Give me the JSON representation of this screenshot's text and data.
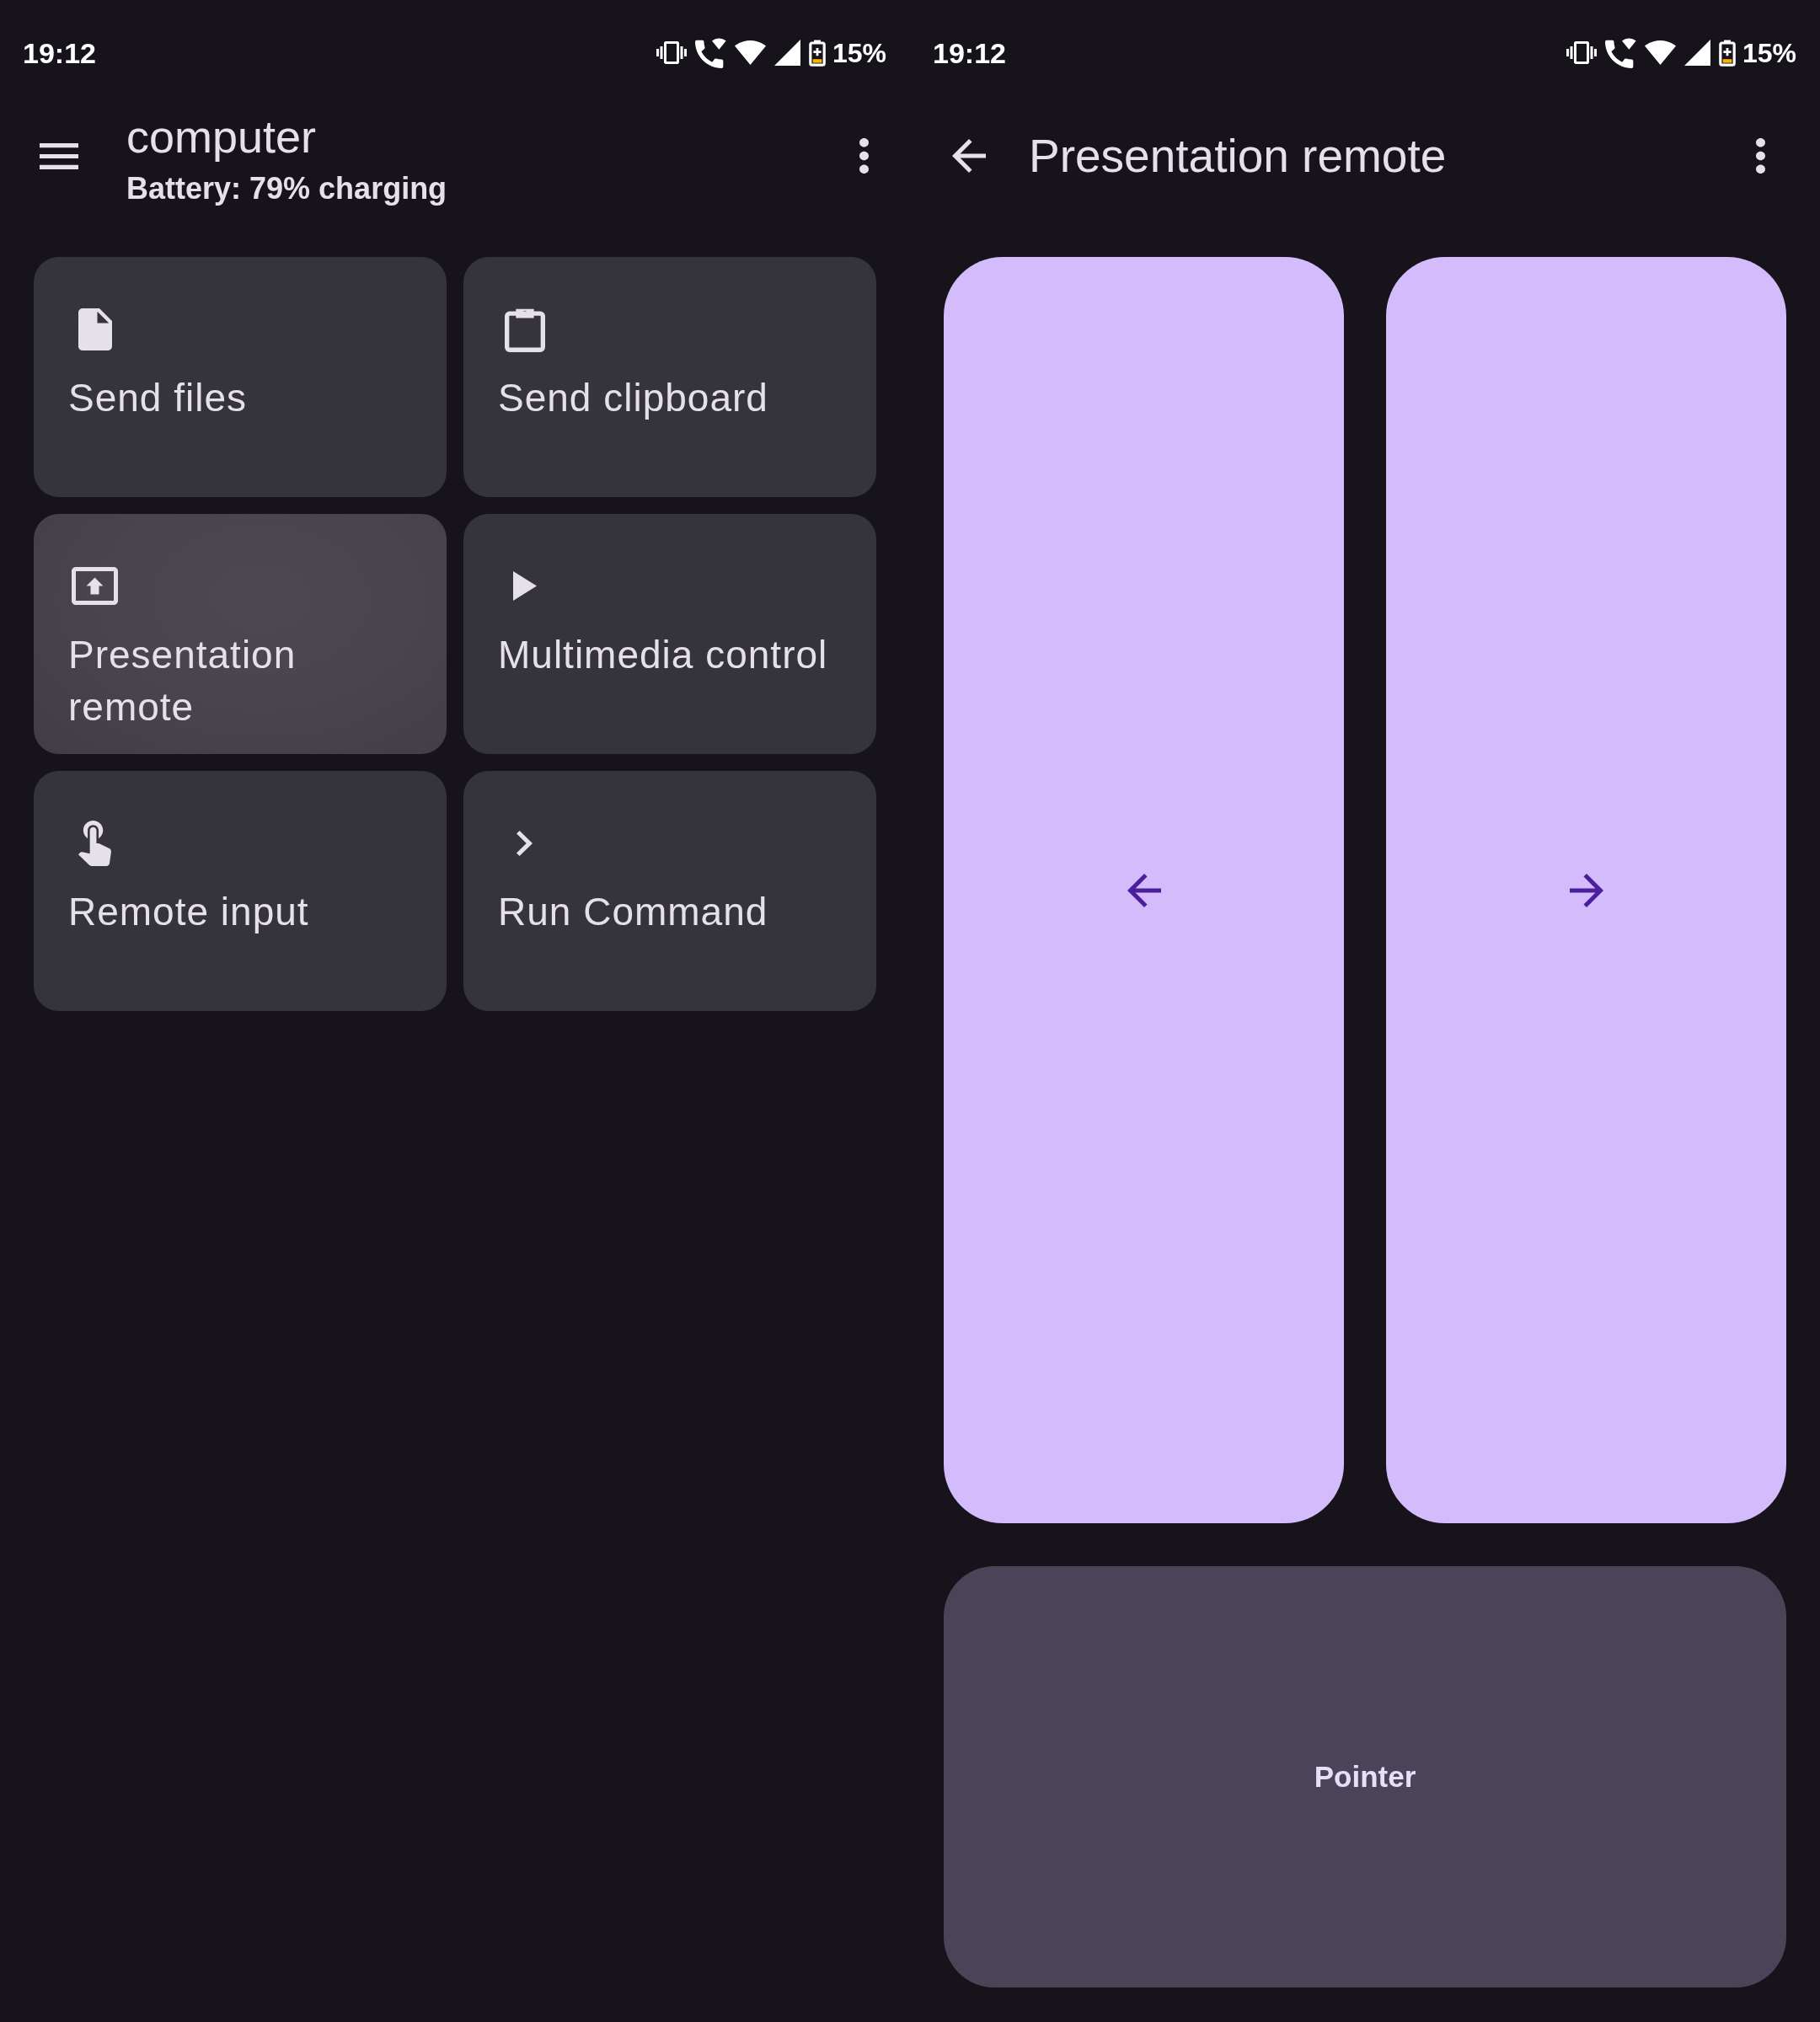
{
  "device_screen": {
    "status_bar": {
      "time": "19:12",
      "battery_percent": "15%"
    },
    "app_bar": {
      "title": "computer",
      "subtitle": "Battery: 79% charging"
    },
    "plugins": [
      {
        "kind": "share",
        "label": "Send files",
        "pressed": false
      },
      {
        "kind": "clipboard",
        "label": "Send clipboard",
        "pressed": false
      },
      {
        "kind": "presenter",
        "label": "Presentation remote",
        "pressed": true
      },
      {
        "kind": "media",
        "label": "Multimedia control",
        "pressed": false
      },
      {
        "kind": "input",
        "label": "Remote input",
        "pressed": false
      },
      {
        "kind": "command",
        "label": "Run Command",
        "pressed": false
      }
    ]
  },
  "remote_screen": {
    "status_bar": {
      "time": "19:12",
      "battery_percent": "15%"
    },
    "app_bar": {
      "title": "Presentation remote"
    },
    "slide_buttons": [
      {
        "kind": "previous"
      },
      {
        "kind": "next"
      }
    ],
    "pointer_button": {
      "label": "Pointer"
    }
  }
}
